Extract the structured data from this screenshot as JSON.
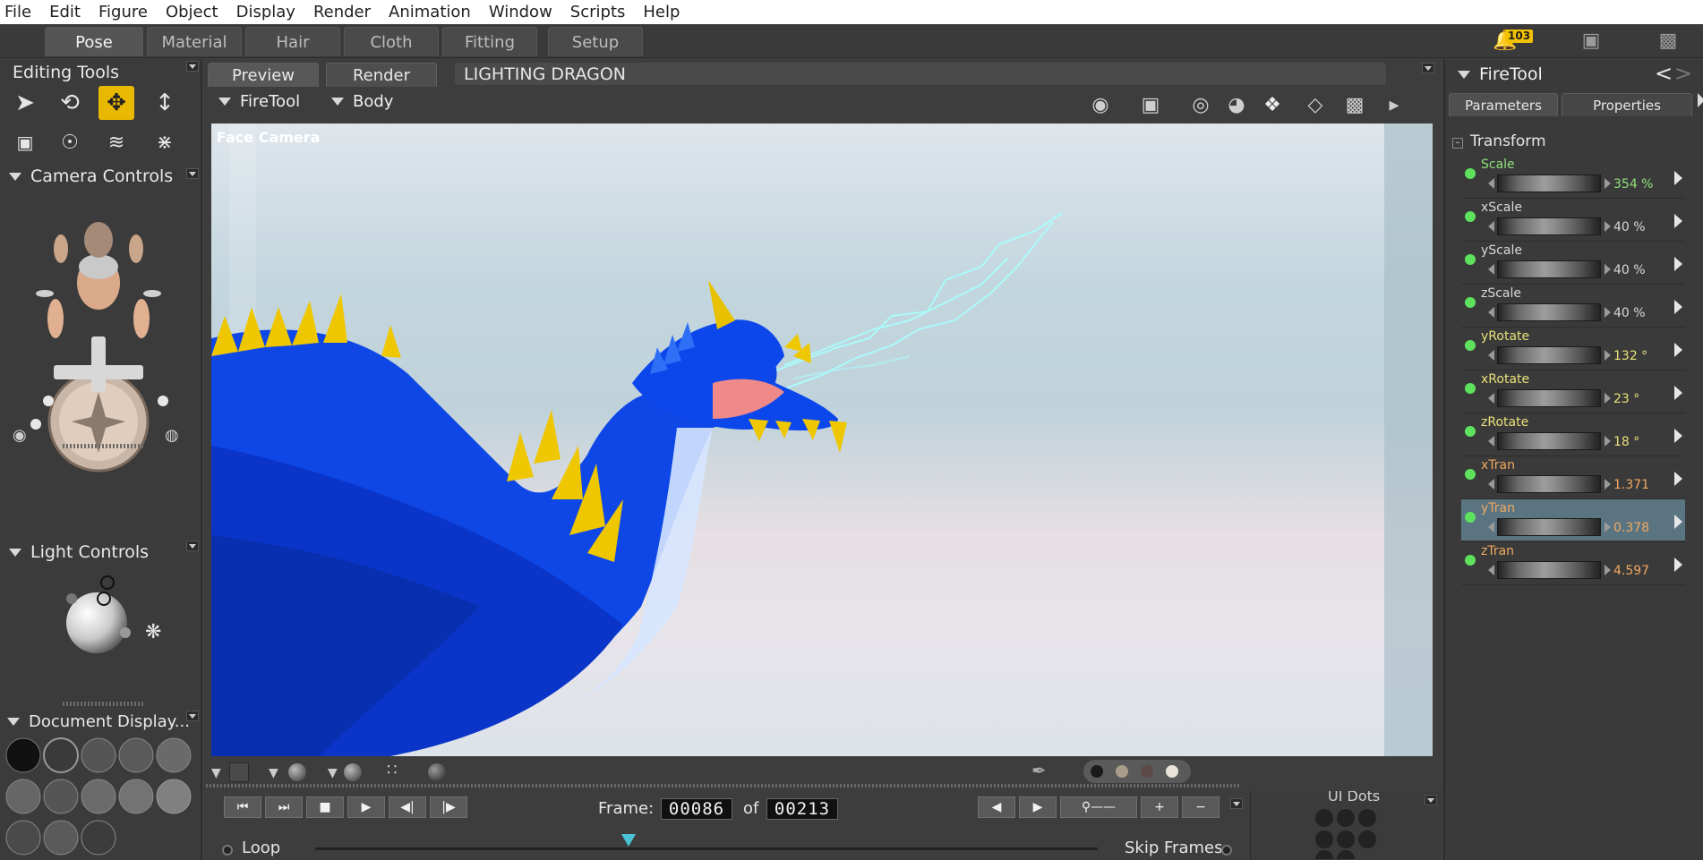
{
  "menu": [
    "File",
    "Edit",
    "Figure",
    "Object",
    "Display",
    "Render",
    "Animation",
    "Window",
    "Scripts",
    "Help"
  ],
  "rooms": [
    "Pose",
    "Material",
    "Hair",
    "Cloth",
    "Fitting",
    "Setup"
  ],
  "notifications_count": "103",
  "left": {
    "editing_tools_title": "Editing Tools",
    "camera_controls_title": "Camera Controls",
    "light_controls_title": "Light Controls",
    "document_display_title": "Document Display..."
  },
  "viewport": {
    "tabs": [
      "Preview",
      "Render"
    ],
    "scene_title": "LIGHTING DRAGON",
    "figure_menu": "FireTool",
    "actor_menu": "Body",
    "camera_label": "Face Camera"
  },
  "animation": {
    "frame_label": "Frame:",
    "current_frame": "00086",
    "of_label": "of",
    "total_frames": "00213",
    "loop_label": "Loop",
    "skip_frames_label": "Skip Frames",
    "ui_dots_label": "UI Dots"
  },
  "right": {
    "title": "FireTool",
    "tabs": [
      "Parameters",
      "Properties"
    ],
    "group": "Transform",
    "params": [
      {
        "name": "Scale",
        "value": "354 %",
        "color": "#8fe07a"
      },
      {
        "name": "xScale",
        "value": "40 %",
        "color": "#d8d8d8"
      },
      {
        "name": "yScale",
        "value": "40 %",
        "color": "#d8d8d8"
      },
      {
        "name": "zScale",
        "value": "40 %",
        "color": "#d8d8d8"
      },
      {
        "name": "yRotate",
        "value": "132 °",
        "color": "#e8e07a"
      },
      {
        "name": "xRotate",
        "value": "23 °",
        "color": "#e8e07a"
      },
      {
        "name": "zRotate",
        "value": "18 °",
        "color": "#e8e07a"
      },
      {
        "name": "xTran",
        "value": "1.371",
        "color": "#f0a860"
      },
      {
        "name": "yTran",
        "value": "0.378",
        "color": "#f0a860"
      },
      {
        "name": "zTran",
        "value": "4.597",
        "color": "#f0a860"
      }
    ]
  }
}
